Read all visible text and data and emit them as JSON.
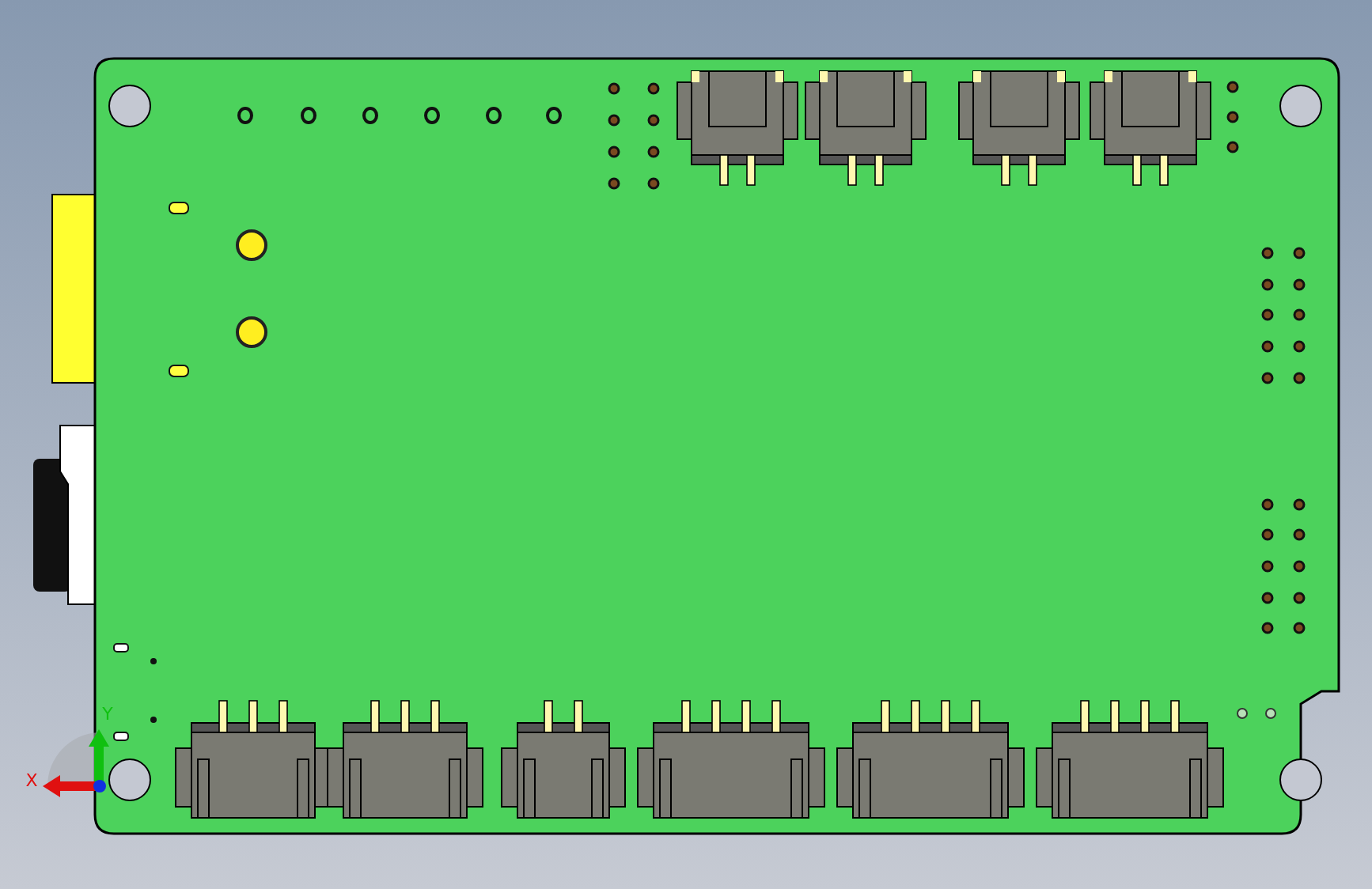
{
  "viewport": {
    "axis_labels": [
      {
        "kind": "x",
        "label": "X"
      },
      {
        "kind": "y",
        "label": "Y"
      }
    ]
  }
}
